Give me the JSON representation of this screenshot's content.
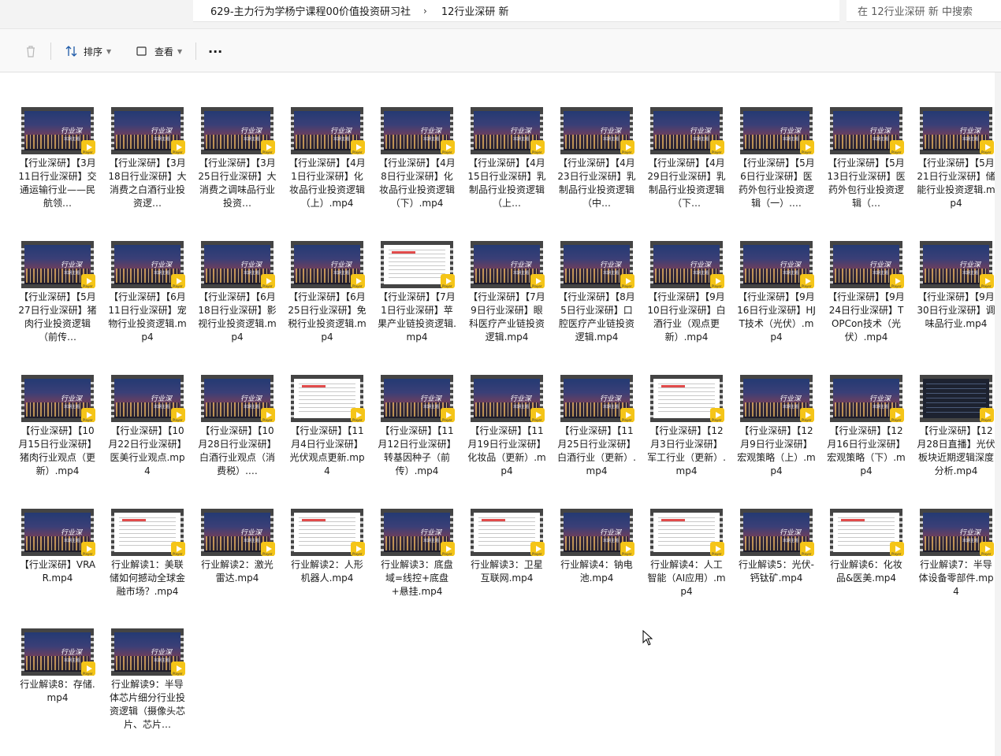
{
  "breadcrumb": {
    "folder": "629-主力行为学杨宁课程00价值投资研习社",
    "separator": "›",
    "current": "12行业深研 新"
  },
  "search": {
    "placeholder": "在 12行业深研 新 中搜索"
  },
  "toolbar": {
    "sort_label": "排序",
    "view_label": "查看",
    "more_label": "···"
  },
  "thumbnail_badge": "Player",
  "files": [
    {
      "name": "【行业深研】【3月11日行业深研】交通运输行业——民航领…",
      "thumb": "city"
    },
    {
      "name": "【行业深研】【3月18日行业深研】大消费之白酒行业投资逻…",
      "thumb": "city"
    },
    {
      "name": "【行业深研】【3月25日行业深研】大消费之调味品行业投资…",
      "thumb": "city"
    },
    {
      "name": "【行业深研】【4月1日行业深研】化妆品行业投资逻辑（上）.mp4",
      "thumb": "city"
    },
    {
      "name": "【行业深研】【4月8日行业深研】化妆品行业投资逻辑（下）.mp4",
      "thumb": "city"
    },
    {
      "name": "【行业深研】【4月15日行业深研】乳制品行业投资逻辑（上…",
      "thumb": "city"
    },
    {
      "name": "【行业深研】【4月23日行业深研】乳制品行业投资逻辑（中…",
      "thumb": "city"
    },
    {
      "name": "【行业深研】【4月29日行业深研】乳制品行业投资逻辑（下…",
      "thumb": "city"
    },
    {
      "name": "【行业深研】【5月6日行业深研】医药外包行业投资逻辑（一）.…",
      "thumb": "city"
    },
    {
      "name": "【行业深研】【5月13日行业深研】医药外包行业投资逻辑（…",
      "thumb": "city"
    },
    {
      "name": "【行业深研】【5月21日行业深研】储能行业投资逻辑.mp4",
      "thumb": "city"
    },
    {
      "name": "【行业深研】【5月27日行业深研】猪肉行业投资逻辑（前传…",
      "thumb": "city"
    },
    {
      "name": "【行业深研】【6月11日行业深研】宠物行业投资逻辑.mp4",
      "thumb": "city"
    },
    {
      "name": "【行业深研】【6月18日行业深研】影视行业投资逻辑.mp4",
      "thumb": "city"
    },
    {
      "name": "【行业深研】【6月25日行业深研】免税行业投资逻辑.mp4",
      "thumb": "city"
    },
    {
      "name": "【行业深研】【7月1日行业深研】苹果产业链投资逻辑.mp4",
      "thumb": "doc"
    },
    {
      "name": "【行业深研】【7月9日行业深研】眼科医疗产业链投资逻辑.mp4",
      "thumb": "city"
    },
    {
      "name": "【行业深研】【8月5日行业深研】口腔医疗产业链投资逻辑.mp4",
      "thumb": "city"
    },
    {
      "name": "【行业深研】【9月10日行业深研】白酒行业（观点更新）.mp4",
      "thumb": "city"
    },
    {
      "name": "【行业深研】【9月16日行业深研】HJT技术（光伏）.mp4",
      "thumb": "city"
    },
    {
      "name": "【行业深研】【9月24日行业深研】TOPCon技术（光伏）.mp4",
      "thumb": "city"
    },
    {
      "name": "【行业深研】【9月30日行业深研】调味品行业.mp4",
      "thumb": "city"
    },
    {
      "name": "【行业深研】【10月15日行业深研】猪肉行业观点（更新）.mp4",
      "thumb": "city"
    },
    {
      "name": "【行业深研】【10月22日行业深研】医美行业观点.mp4",
      "thumb": "city"
    },
    {
      "name": "【行业深研】【10月28日行业深研】白酒行业观点（消费税）.…",
      "thumb": "city"
    },
    {
      "name": "【行业深研】【11月4日行业深研】光伏观点更新.mp4",
      "thumb": "doc"
    },
    {
      "name": "【行业深研】【11月12日行业深研】转基因种子（前传）.mp4",
      "thumb": "city"
    },
    {
      "name": "【行业深研】【11月19日行业深研】化妆品（更新）.mp4",
      "thumb": "city"
    },
    {
      "name": "【行业深研】【11月25日行业深研】白酒行业（更新）.mp4",
      "thumb": "city"
    },
    {
      "name": "【行业深研】【12月3日行业深研】军工行业（更新）.mp4",
      "thumb": "doc"
    },
    {
      "name": "【行业深研】【12月9日行业深研】宏观策略（上）.mp4",
      "thumb": "city"
    },
    {
      "name": "【行业深研】【12月16日行业深研】宏观策略（下）.mp4",
      "thumb": "city"
    },
    {
      "name": "【行业深研】【12月28日直播】光伏板块近期逻辑深度分析.mp4",
      "thumb": "dark"
    },
    {
      "name": "【行业深研】VRAR.mp4",
      "thumb": "city"
    },
    {
      "name": "行业解读1：美联储如何撼动全球金融市场？.mp4",
      "thumb": "doc"
    },
    {
      "name": "行业解读2：激光雷达.mp4",
      "thumb": "city"
    },
    {
      "name": "行业解读2：人形机器人.mp4",
      "thumb": "doc"
    },
    {
      "name": "行业解读3：底盘域=线控+底盘+悬挂.mp4",
      "thumb": "city"
    },
    {
      "name": "行业解读3：卫星互联网.mp4",
      "thumb": "doc"
    },
    {
      "name": "行业解读4：钠电池.mp4",
      "thumb": "city"
    },
    {
      "name": "行业解读4：人工智能（AI应用）.mp4",
      "thumb": "doc"
    },
    {
      "name": "行业解读5：光伏-钙钛矿.mp4",
      "thumb": "city"
    },
    {
      "name": "行业解读6：化妆品&医美.mp4",
      "thumb": "doc"
    },
    {
      "name": "行业解读7：半导体设备零部件.mp4",
      "thumb": "city"
    },
    {
      "name": "行业解读8：存储.mp4",
      "thumb": "city"
    },
    {
      "name": "行业解读9：半导体芯片细分行业投资逻辑（摄像头芯片、芯片…",
      "thumb": "city"
    }
  ]
}
